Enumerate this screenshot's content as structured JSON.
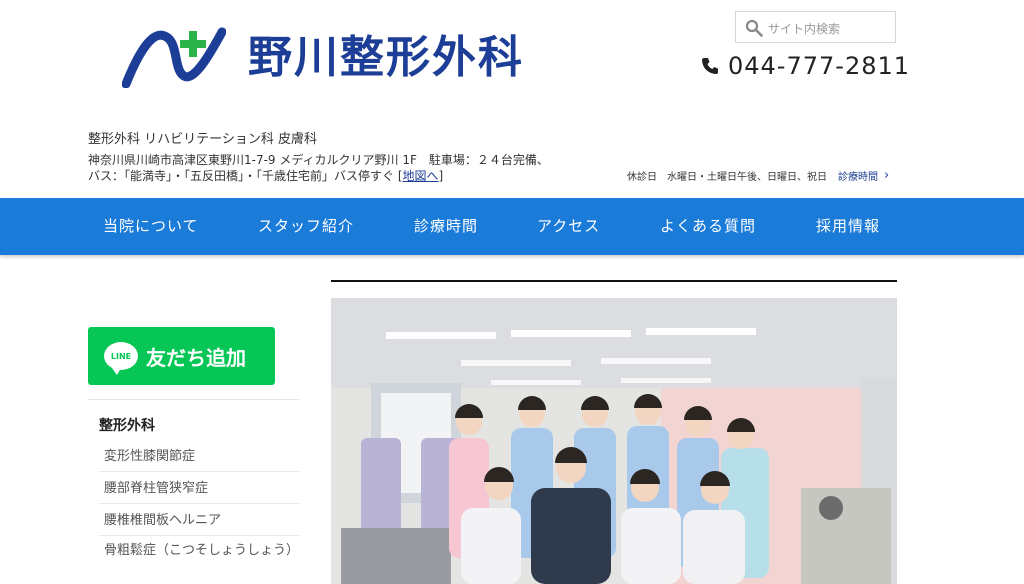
{
  "header": {
    "clinic_name": "野川整形外科",
    "search_placeholder": "サイト内検索",
    "phone": "044-777-2811",
    "departments": "整形外科 リハビリテーション科 皮膚科",
    "address_line1": "神奈川県川崎市高津区東野川1-7-9 メディカルクリア野川 1F　駐車場：２４台完備、",
    "address_line2": "バス：「能満寺」・「五反田橋」・「千歳住宅前」バス停すぐ",
    "map_link": "地図へ",
    "holiday": "休診日　水曜日・土曜日午後、日曜日、祝日",
    "hours_link": "診療時間"
  },
  "nav": {
    "items": [
      "当院について",
      "スタッフ紹介",
      "診療時間",
      "アクセス",
      "よくある質問",
      "採用情報"
    ]
  },
  "sidebar": {
    "line_label": "友だち追加",
    "line_logo_text": "LINE",
    "heading": "整形外科",
    "items": [
      "変形性膝関節症",
      "腰部脊柱管狭窄症",
      "腰椎椎間板ヘルニア",
      "骨粗鬆症（こつそしょうしょう）"
    ]
  },
  "icons": {
    "logo": "clinic-logo-icon",
    "search": "search-icon",
    "phone": "phone-icon",
    "chevron": "chevron-right-icon"
  },
  "colors": {
    "brand_blue": "#1d3e96",
    "nav_blue": "#1a7bd9",
    "logo_green": "#2bb34a",
    "line_green": "#06c755"
  }
}
